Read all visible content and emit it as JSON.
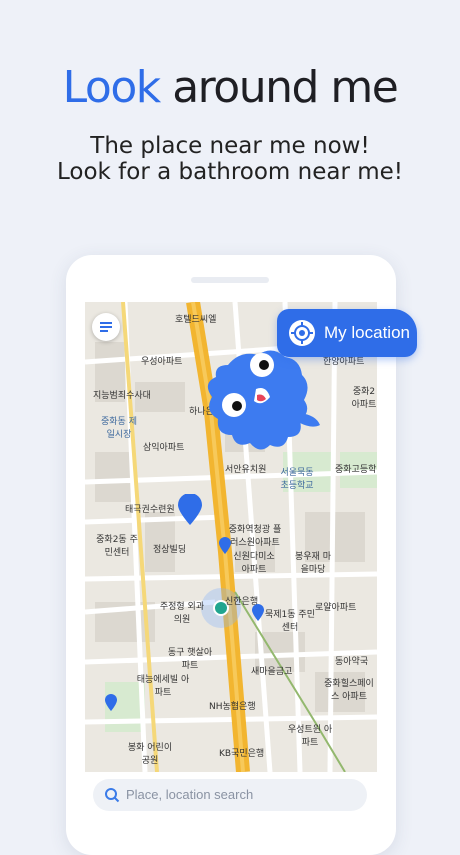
{
  "headline": {
    "accent": "Look",
    "rest": " around me"
  },
  "subtitle": {
    "line1": "The place near me now!",
    "line2": "Look for a bathroom near me!"
  },
  "map": {
    "my_location_label": "My location",
    "search_placeholder": "Place, location search",
    "labels": [
      "호텔드씨엘",
      "우성아파트",
      "지능범죄수사대",
      "중화동 제일시장",
      "하나은",
      "삼익아파트",
      "서안유치원",
      "서울묵동 초등학교",
      "중화고등학",
      "태극권수련원",
      "중화2동 주민센터",
      "정상빌딩",
      "중화역청광 플러스원아파트",
      "신원다미소 아파트",
      "봉우재 마을마당",
      "주정형 외과의원",
      "신한은행",
      "묵제1동 주민센터",
      "로얄아파트",
      "동구 햇살아파트",
      "새마을금고",
      "동아약국",
      "태능에세빌 아파트",
      "중화힐스페이스 아파트",
      "NH농협은행",
      "우성트윈 아파트",
      "봉화 어린이공원",
      "KB국민은행",
      "중화2 아파트",
      "한양아파트"
    ]
  },
  "colors": {
    "accent": "#2f6de8",
    "mascot": "#3d7bf0",
    "road_main": "#f2b530"
  },
  "icons": {
    "menu": "menu-icon",
    "location": "crosshair-icon",
    "search": "search-icon"
  }
}
